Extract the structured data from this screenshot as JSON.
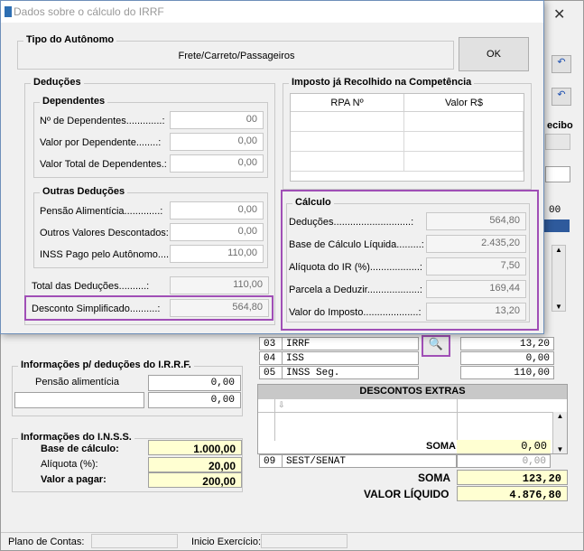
{
  "dialog": {
    "title": "Dados sobre o cálculo do IRRF",
    "tipo": {
      "title": "Tipo do Autônomo",
      "value": "Frete/Carreto/Passageiros",
      "ok_label": "OK"
    },
    "deducoes": {
      "title": "Deduções",
      "dependentes": {
        "title": "Dependentes",
        "rows": [
          {
            "label": "Nº de Dependentes.............:",
            "value": "00"
          },
          {
            "label": "Valor por Dependente........:",
            "value": "0,00"
          },
          {
            "label": "Valor Total de Dependentes.:",
            "value": "0,00"
          }
        ]
      },
      "outras": {
        "title": "Outras Deduções",
        "rows": [
          {
            "label": "Pensão Alimentícia.............:",
            "value": "0,00"
          },
          {
            "label": "Outros Valores Descontados:",
            "value": "0,00"
          },
          {
            "label": "INSS Pago pelo Autônomo....:",
            "value": "110,00"
          }
        ]
      },
      "total": {
        "label": "Total das Deduções..........:",
        "value": "110,00"
      },
      "desconto": {
        "label": "Desconto Simplificado..........:",
        "value": "564,80"
      }
    },
    "imposto": {
      "title": "Imposto já Recolhido na Competência",
      "col1": "RPA Nº",
      "col2": "Valor R$"
    },
    "calculo": {
      "title": "Cálculo",
      "rows": [
        {
          "label": "Deduções............................:",
          "value": "564,80"
        },
        {
          "label": "Base de Cálculo Líquida.........:",
          "value": "2.435,20"
        },
        {
          "label": "Alíquota do IR (%)..................:",
          "value": "7,50"
        },
        {
          "label": "Parcela a Deduzir...................:",
          "value": "169,44"
        },
        {
          "label": "Valor do Imposto....................:",
          "value": "13,20"
        }
      ]
    }
  },
  "background": {
    "recibo": "ecibo",
    "partial_value": "00",
    "irrf_info": {
      "title": "Informações p/ deduções do I.R.R.F.",
      "pensao_label": "Pensão alimentícia",
      "pensao_value": "0,00",
      "second_value": "0,00"
    },
    "inss_info": {
      "title": "Informações do I.N.S.S.",
      "rows": [
        {
          "label": "Base de cálculo:",
          "value": "1.000,00"
        },
        {
          "label": "Alíquota (%):",
          "value": "20,00"
        },
        {
          "label": "Valor a pagar:",
          "value": "200,00"
        }
      ]
    },
    "impostos": [
      {
        "code": "03",
        "name": "IRRF",
        "value": "13,20"
      },
      {
        "code": "04",
        "name": "ISS",
        "value": "0,00"
      },
      {
        "code": "05",
        "name": "INSS Seg.",
        "value": "110,00"
      }
    ],
    "descontos_extras": {
      "title": "DESCONTOS EXTRAS",
      "soma_label": "SOMA",
      "soma_value": "0,00"
    },
    "sest": {
      "code": "09",
      "name": "SEST/SENAT",
      "value": "0,00"
    },
    "soma": {
      "label": "SOMA",
      "value": "123,20"
    },
    "liquido": {
      "label": "VALOR LÍQUIDO",
      "value": "4.876,80"
    },
    "status": {
      "plano_label": "Plano de Contas:",
      "inicio_label": "Inicio Exercício:"
    }
  }
}
